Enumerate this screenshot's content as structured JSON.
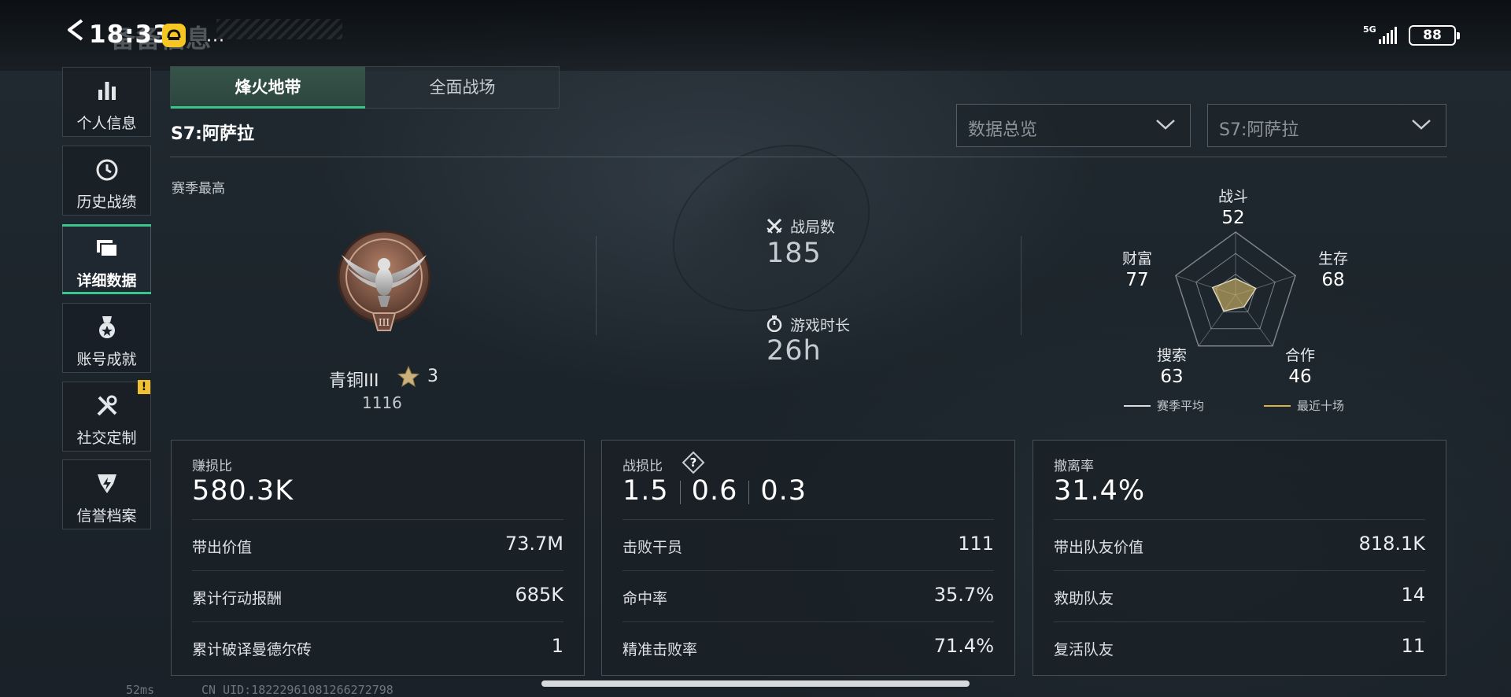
{
  "status_bar": {
    "time": "18:33",
    "page_title": "备备信息",
    "network": "5G",
    "battery": "88"
  },
  "sidebar": {
    "items": [
      {
        "label": "个人信息",
        "icon": "bar-chart-icon"
      },
      {
        "label": "历史战绩",
        "icon": "history-clock-icon"
      },
      {
        "label": "详细数据",
        "icon": "folder-icon",
        "active": true
      },
      {
        "label": "账号成就",
        "icon": "medal-icon"
      },
      {
        "label": "社交定制",
        "icon": "tools-icon",
        "badge": "!"
      },
      {
        "label": "信誉档案",
        "icon": "shield-badge-icon"
      }
    ]
  },
  "tabs": [
    "烽火地带",
    "全面战场"
  ],
  "season_title": "S7:阿萨拉",
  "filters": {
    "view_select": "数据总览",
    "season_select": "S7:阿萨拉"
  },
  "season_best": {
    "label": "赛季最高",
    "rank": "青铜III",
    "stars": "3",
    "points": "1116",
    "emblem": "bronze-eagle-emblem",
    "emblem_tier": "III"
  },
  "totals": {
    "matches_label": "战局数",
    "matches_value": "185",
    "playtime_label": "游戏时长",
    "playtime_value": "26h"
  },
  "radar": {
    "axes": [
      {
        "label": "战斗",
        "value": 52
      },
      {
        "label": "生存",
        "value": 68
      },
      {
        "label": "合作",
        "value": 46
      },
      {
        "label": "搜索",
        "value": 63
      },
      {
        "label": "财富",
        "value": 77
      }
    ],
    "legend": [
      "赛季平均",
      "最近十场"
    ],
    "colors": {
      "season_avg": "#d9dde1",
      "recent": "#d9b34a"
    }
  },
  "cards": [
    {
      "title": "赚损比",
      "big": "580.3K",
      "rows": [
        {
          "k": "带出价值",
          "v": "73.7M"
        },
        {
          "k": "累计行动报酬",
          "v": "685K"
        },
        {
          "k": "累计破译曼德尔砖",
          "v": "1"
        }
      ]
    },
    {
      "title": "战损比",
      "kd": [
        "1.5",
        "0.6",
        "0.3"
      ],
      "rows": [
        {
          "k": "击败干员",
          "v": "111"
        },
        {
          "k": "命中率",
          "v": "35.7%"
        },
        {
          "k": "精准击败率",
          "v": "71.4%"
        }
      ]
    },
    {
      "title": "撤离率",
      "big": "31.4%",
      "rows": [
        {
          "k": "带出队友价值",
          "v": "818.1K"
        },
        {
          "k": "救助队友",
          "v": "14"
        },
        {
          "k": "复活队友",
          "v": "11"
        }
      ]
    }
  ],
  "footer": {
    "ping": "52ms",
    "uid": "CN UID:1822296108126627279​8"
  },
  "accent_color": "#39c58c"
}
